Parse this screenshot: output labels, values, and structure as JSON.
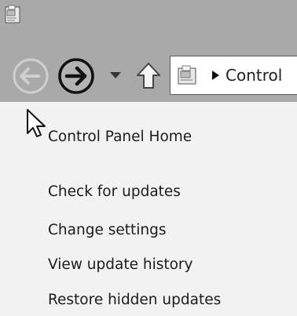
{
  "window": {
    "app_icon": "control-panel-icon"
  },
  "navigation": {
    "back_icon": "back-arrow-icon",
    "forward_icon": "forward-arrow-icon",
    "recent_icon": "chevron-down-icon",
    "up_icon": "up-arrow-icon"
  },
  "address_bar": {
    "location_icon": "control-panel-icon",
    "separator_icon": "triangle-right-icon",
    "path_text": "Control"
  },
  "sidebar": {
    "home_link": "Control Panel Home",
    "links": [
      "Check for updates",
      "Change settings",
      "View update history",
      "Restore hidden updates"
    ]
  },
  "colors": {
    "titlebar": "#a9a9a9",
    "content_background": "#f2f2f2",
    "text": "#1b1b1b"
  }
}
